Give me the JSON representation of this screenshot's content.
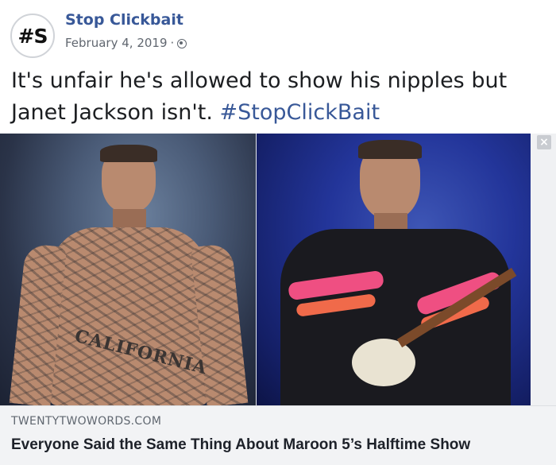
{
  "post": {
    "avatar_text": "#S",
    "page_name": "Stop Clickbait",
    "date": "February 4, 2019",
    "separator": "·",
    "privacy_icon": "globe-icon",
    "text": "It's unfair he's allowed to show his nipples but Janet Jackson isn't. ",
    "hashtag": "#StopClickBait"
  },
  "photo": {
    "left_tattoo_text": "CALIFORNIA",
    "close_glyph": "×"
  },
  "link": {
    "domain": "TWENTYTWOWORDS.COM",
    "title": "Everyone Said the Same Thing About Maroon 5’s Halftime Show"
  },
  "colors": {
    "link_blue": "#385898",
    "preview_bg": "#f2f3f5"
  }
}
